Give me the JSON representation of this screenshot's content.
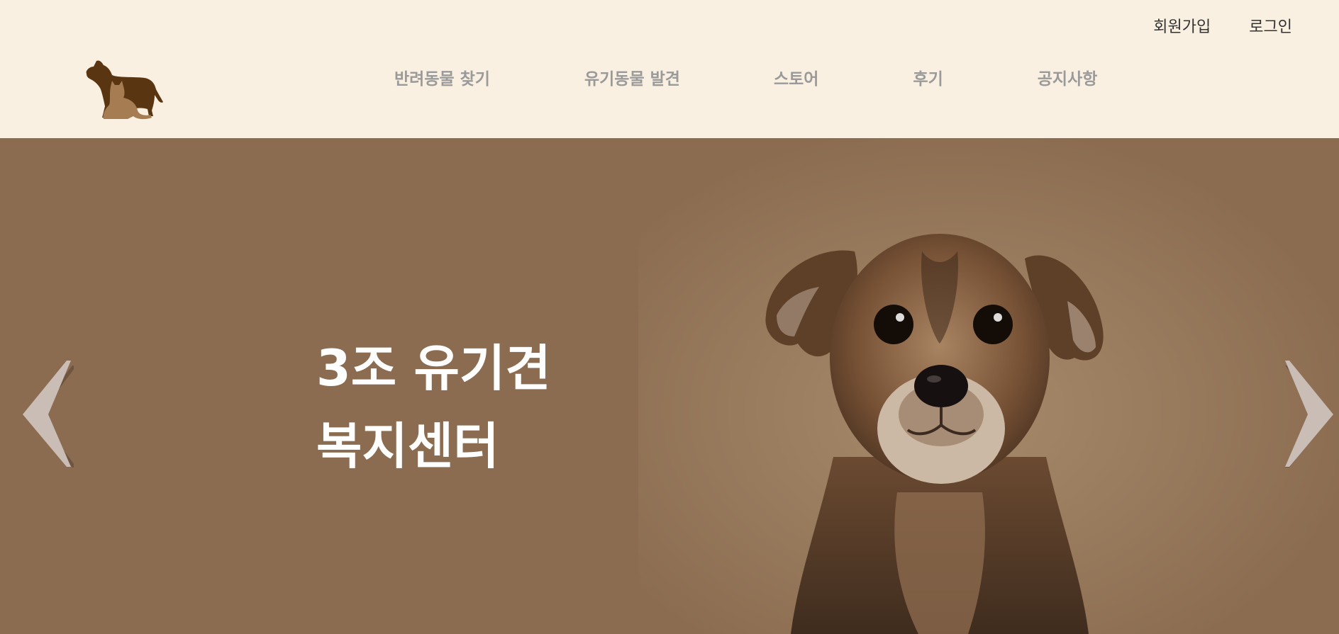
{
  "header": {
    "logo_icon": "dog-and-cat-silhouette-icon",
    "util_nav": [
      {
        "label": "회원가입"
      },
      {
        "label": "로그인"
      }
    ],
    "main_nav": [
      {
        "label": "반려동물 찾기"
      },
      {
        "label": "유기동물 발견"
      },
      {
        "label": "스토어"
      },
      {
        "label": "후기"
      },
      {
        "label": "공지사항"
      }
    ]
  },
  "hero": {
    "title_line1": "3조 유기견",
    "title_line2": "복지센터",
    "prev_icon": "chevron-left-icon",
    "next_icon": "chevron-right-icon"
  },
  "colors": {
    "header_bg": "#faf0e1",
    "hero_bg": "#8b6c50",
    "nav_text": "#9a9a9a",
    "util_text": "#333333",
    "arrow": "#c9bdb5",
    "logo_dog": "#5a3512",
    "logo_cat": "#a67c52"
  }
}
